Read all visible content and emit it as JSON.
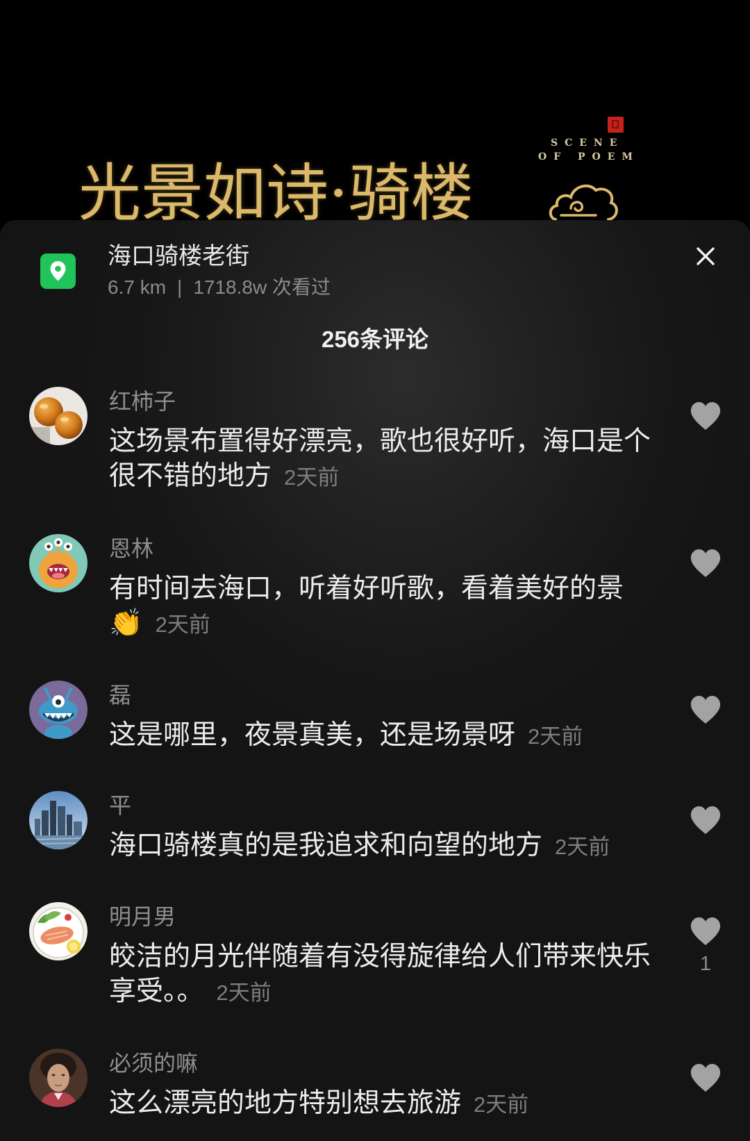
{
  "colors": {
    "banner_gold": "#dcb96a",
    "location_green": "#21c35b",
    "panel_bg": "#161616",
    "muted_text": "#8c8c8c",
    "like_icon": "#a3a3a3"
  },
  "icons": {
    "location": "map-pin-icon",
    "close": "close-icon",
    "like": "heart-icon",
    "banner_cloud": "cloud-icon",
    "banner_seal": "seal-stamp"
  },
  "banner": {
    "title": "光景如诗·骑楼",
    "tagline_line1": "SCENE",
    "tagline_line2": "OF POEM"
  },
  "location": {
    "name": "海口骑楼老街",
    "distance": "6.7 km",
    "separator": "|",
    "views": "1718.8w 次看过"
  },
  "comments_count_label": "256条评论",
  "comments": [
    {
      "user": "红柿子",
      "text": "这场景布置得好漂亮，歌也很好听，海口是个很不错的地方",
      "time": "2天前"
    },
    {
      "user": "恩林",
      "text": "有时间去海口，听着好听歌，看着美好的景👏",
      "time": "2天前"
    },
    {
      "user": "磊",
      "text": "这是哪里，夜景真美，还是场景呀",
      "time": "2天前"
    },
    {
      "user": "平",
      "text": "海口骑楼真的是我追求和向望的地方",
      "time": "2天前"
    },
    {
      "user": "明月男",
      "text": "皎洁的月光伴随着有没得旋律给人们带来快乐享受。。",
      "time": "2天前",
      "likes": "1"
    },
    {
      "user": "必须的嘛",
      "text": "这么漂亮的地方特别想去旅游",
      "time": "2天前"
    }
  ]
}
